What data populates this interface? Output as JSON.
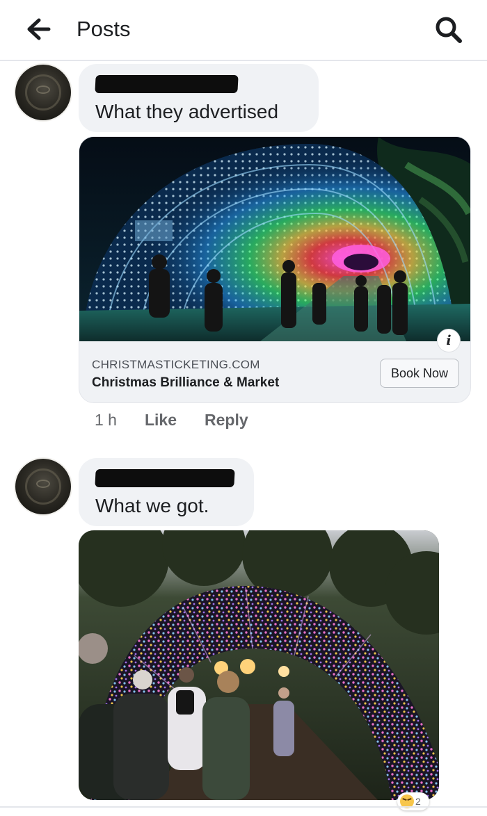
{
  "header": {
    "title": "Posts",
    "back_icon": "arrow-left-icon",
    "search_icon": "search-icon"
  },
  "comments": [
    {
      "author_redacted": true,
      "text": "What they advertised",
      "link_preview": {
        "domain": "CHRISTMASTICKETING.COM",
        "title": "Christmas Brilliance & Market",
        "cta_label": "Book Now",
        "info_label": "i",
        "image": "rainbow-light-tunnel"
      },
      "actions": {
        "time": "1 h",
        "like_label": "Like",
        "reply_label": "Reply"
      }
    },
    {
      "author_redacted": true,
      "text": "What we got.",
      "photo": "small-light-tunnel-at-dusk",
      "reaction": {
        "icon": "haha-emoji-icon",
        "count_label": "2"
      }
    }
  ],
  "colors": {
    "bubble": "#f0f2f5",
    "muted_text": "#65676b",
    "divider": "#e4e6eb"
  }
}
